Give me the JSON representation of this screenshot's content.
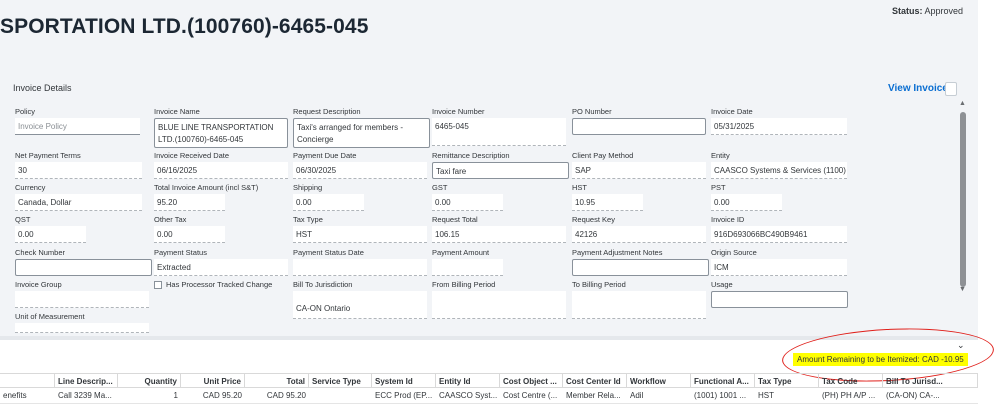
{
  "header": {
    "status_label": "Status:",
    "status_value": "Approved",
    "title": "SPORTATION LTD.(100760)-6465-045"
  },
  "section": {
    "title": "Invoice Details",
    "view_invoice": "View Invoice"
  },
  "fields": {
    "policy": {
      "label": "Policy",
      "value": "Invoice Policy"
    },
    "invoice_name": {
      "label": "Invoice Name",
      "value": "BLUE LINE TRANSPORTATION LTD.(100760)-6465-045"
    },
    "request_description": {
      "label": "Request Description",
      "value": "Taxi's arranged for members - Concierge"
    },
    "invoice_number": {
      "label": "Invoice Number",
      "value": "6465-045"
    },
    "po_number": {
      "label": "PO Number",
      "value": ""
    },
    "invoice_date": {
      "label": "Invoice Date",
      "value": "05/31/2025"
    },
    "net_payment_terms": {
      "label": "Net Payment Terms",
      "value": "30"
    },
    "invoice_received_date": {
      "label": "Invoice Received Date",
      "value": "06/16/2025"
    },
    "payment_due_date": {
      "label": "Payment Due Date",
      "value": "06/30/2025"
    },
    "remittance_description": {
      "label": "Remittance Description",
      "value": "Taxi fare"
    },
    "client_pay_method": {
      "label": "Client Pay Method",
      "value": "SAP"
    },
    "entity": {
      "label": "Entity",
      "value": "CAASCO Systems & Services (1100)"
    },
    "currency": {
      "label": "Currency",
      "value": "Canada, Dollar"
    },
    "total_invoice_amount": {
      "label": "Total Invoice Amount (incl S&T)",
      "value": "95.20"
    },
    "shipping": {
      "label": "Shipping",
      "value": "0.00"
    },
    "gst": {
      "label": "GST",
      "value": "0.00"
    },
    "hst": {
      "label": "HST",
      "value": "10.95"
    },
    "pst": {
      "label": "PST",
      "value": "0.00"
    },
    "qst": {
      "label": "QST",
      "value": "0.00"
    },
    "other_tax": {
      "label": "Other Tax",
      "value": "0.00"
    },
    "tax_type": {
      "label": "Tax Type",
      "value": "HST"
    },
    "request_total": {
      "label": "Request Total",
      "value": "106.15"
    },
    "request_key": {
      "label": "Request Key",
      "value": "42126"
    },
    "invoice_id": {
      "label": "Invoice ID",
      "value": "916D693066BC490B9461"
    },
    "check_number": {
      "label": "Check Number",
      "value": ""
    },
    "payment_status": {
      "label": "Payment Status",
      "value": "Extracted"
    },
    "payment_status_date": {
      "label": "Payment Status Date",
      "value": ""
    },
    "payment_amount": {
      "label": "Payment Amount",
      "value": ""
    },
    "payment_adjustment_notes": {
      "label": "Payment Adjustment Notes",
      "value": ""
    },
    "origin_source": {
      "label": "Origin Source",
      "value": "ICM"
    },
    "invoice_group": {
      "label": "Invoice Group",
      "value": ""
    },
    "has_processor_tracked_change": {
      "label": "Has Processor Tracked Change"
    },
    "bill_to_jurisdiction": {
      "label": "Bill To Jurisdiction",
      "value": "CA-ON Ontario"
    },
    "from_billing_period": {
      "label": "From Billing Period",
      "value": ""
    },
    "to_billing_period": {
      "label": "To Billing Period",
      "value": ""
    },
    "usage": {
      "label": "Usage",
      "value": ""
    },
    "unit_of_measurement": {
      "label": "Unit of Measurement",
      "value": ""
    }
  },
  "remaining": "Amount Remaining to be Itemized: CAD -10.95",
  "table": {
    "headers": [
      "",
      "Line Descrip...",
      "Quantity",
      "Unit Price",
      "Total",
      "Service Type",
      "System Id",
      "Entity Id",
      "Cost Object ...",
      "Cost Center Id",
      "Workflow",
      "Functional A...",
      "Tax Type",
      "Tax Code",
      "Bill To Jurisd..."
    ],
    "rows": [
      [
        "enefits",
        "Call 3239 Ma...",
        "1",
        "CAD 95.20",
        "CAD 95.20",
        "",
        "ECC Prod (EP...",
        "CAASCO Syst...",
        "Cost Centre (...",
        "Member Rela...",
        "Adil",
        "(1001) 1001 ...",
        "HST",
        "(PH) PH A/P ...",
        "(CA-ON) CA-..."
      ]
    ]
  },
  "colors": {
    "accent": "#0a6ed1",
    "highlight": "#ffff00",
    "annotation": "#e0201b"
  }
}
